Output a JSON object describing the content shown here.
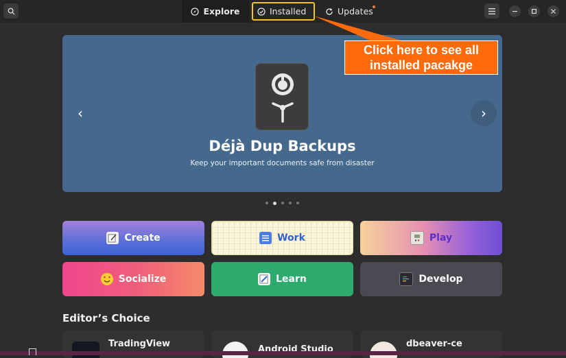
{
  "header": {
    "tabs": [
      {
        "label": "Explore",
        "icon": "compass-icon"
      },
      {
        "label": "Installed",
        "icon": "check-circle-icon"
      },
      {
        "label": "Updates",
        "icon": "refresh-icon"
      }
    ]
  },
  "banner": {
    "title": "Déjà Dup Backups",
    "subtitle": "Keep your important documents safe from disaster",
    "prev_glyph": "‹",
    "next_glyph": "›",
    "color": "#45698c"
  },
  "categories": [
    {
      "label": "Create",
      "icon": "pencil-note-icon"
    },
    {
      "label": "Work",
      "icon": "checklist-icon"
    },
    {
      "label": "Play",
      "icon": "gameboy-icon"
    },
    {
      "label": "Socialize",
      "icon": "heart-eyes-emoji-icon"
    },
    {
      "label": "Learn",
      "icon": "notebook-pencil-icon"
    },
    {
      "label": "Develop",
      "icon": "code-editor-icon"
    }
  ],
  "editors_choice": {
    "title": "Editor’s Choice",
    "apps": [
      "TradingView",
      "Android Studio",
      "dbeaver-ce"
    ]
  },
  "annotation": {
    "callout_text": "Click here to see all installed pacakge",
    "callout_color": "#ff6b0a",
    "highlight_color": "#f5c518"
  }
}
